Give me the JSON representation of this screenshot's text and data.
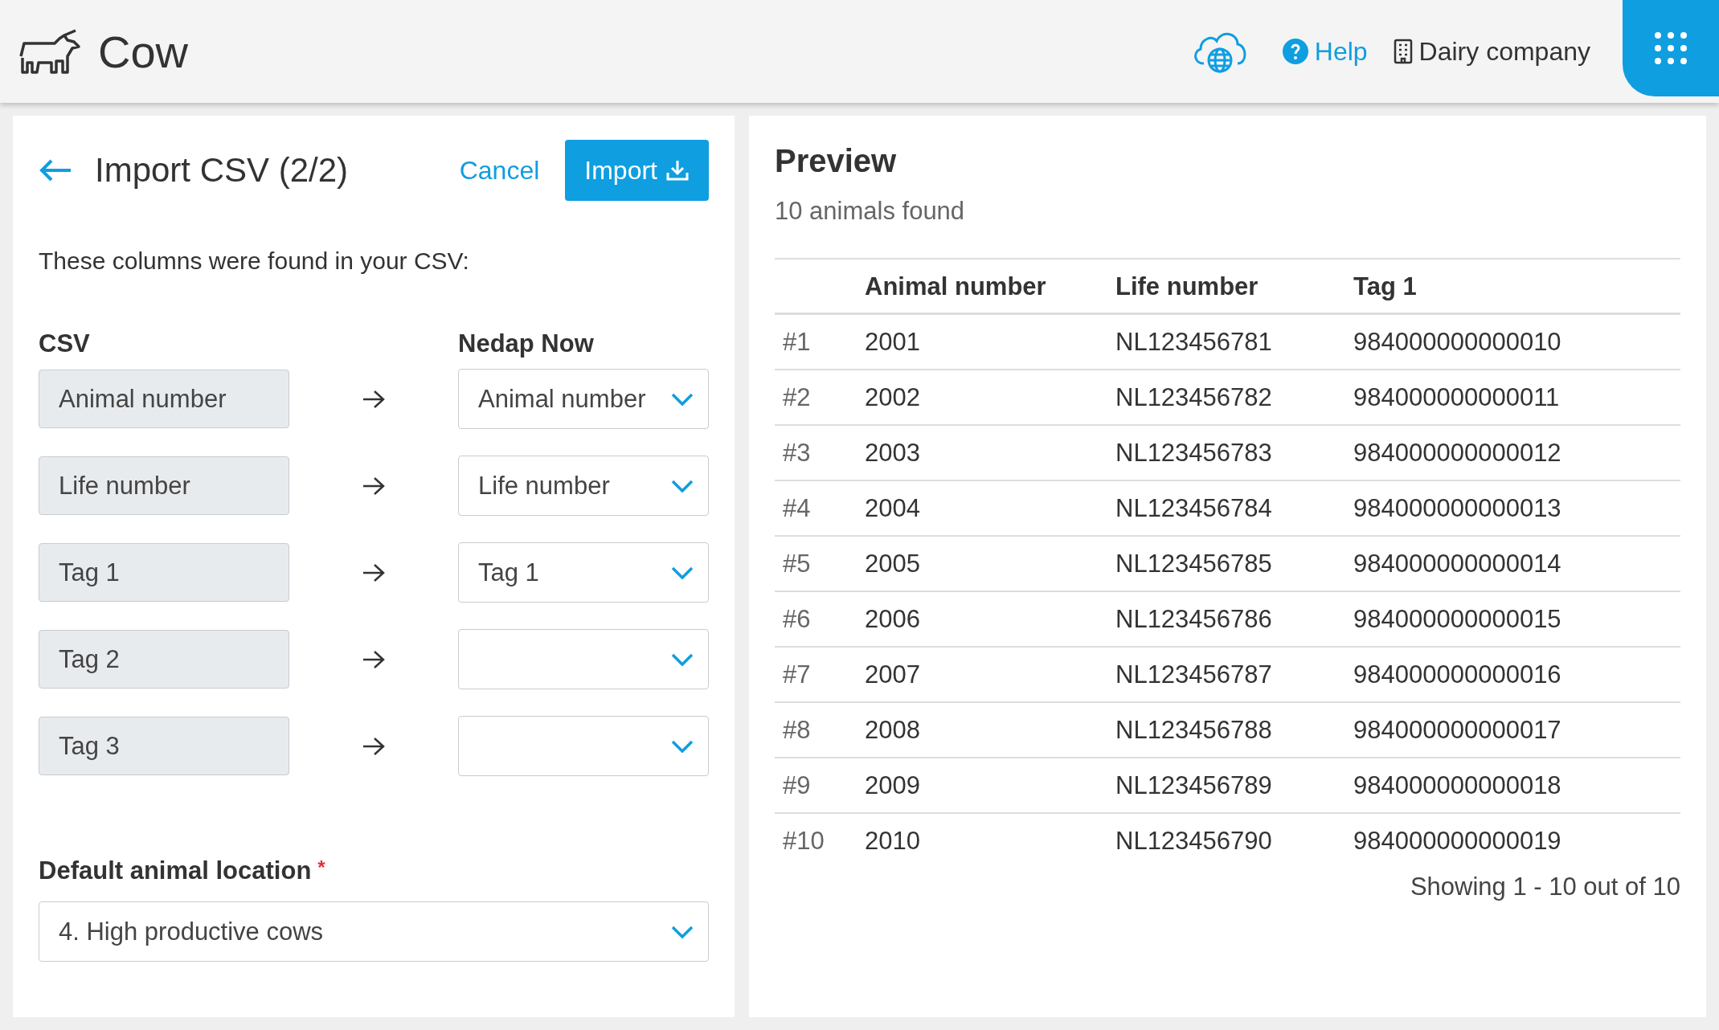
{
  "header": {
    "app_name": "Cow",
    "help": "Help",
    "company": "Dairy company"
  },
  "import": {
    "title": "Import CSV (2/2)",
    "cancel": "Cancel",
    "import_button": "Import",
    "intro": "These columns were found in your CSV:",
    "csv_heading": "CSV",
    "target_heading": "Nedap Now",
    "mappings": [
      {
        "csv": "Animal number",
        "target": "Animal number"
      },
      {
        "csv": "Life number",
        "target": "Life number"
      },
      {
        "csv": "Tag 1",
        "target": "Tag 1"
      },
      {
        "csv": "Tag 2"
      },
      {
        "csv": "Tag 3"
      }
    ],
    "location_label": "Default animal location",
    "location_required_mark": "*",
    "location_value": "4. High productive cows"
  },
  "preview": {
    "title": "Preview",
    "subtitle": "10 animals found",
    "columns": [
      "",
      "Animal number",
      "Life number",
      "Tag 1"
    ],
    "rows": [
      [
        "#1",
        "2001",
        "NL123456781",
        "984000000000010"
      ],
      [
        "#2",
        "2002",
        "NL123456782",
        "984000000000011"
      ],
      [
        "#3",
        "2003",
        "NL123456783",
        "984000000000012"
      ],
      [
        "#4",
        "2004",
        "NL123456784",
        "984000000000013"
      ],
      [
        "#5",
        "2005",
        "NL123456785",
        "984000000000014"
      ],
      [
        "#6",
        "2006",
        "NL123456786",
        "984000000000015"
      ],
      [
        "#7",
        "2007",
        "NL123456787",
        "984000000000016"
      ],
      [
        "#8",
        "2008",
        "NL123456788",
        "984000000000017"
      ],
      [
        "#9",
        "2009",
        "NL123456789",
        "984000000000018"
      ],
      [
        "#10",
        "2010",
        "NL123456790",
        "984000000000019"
      ]
    ],
    "pagination": "Showing 1 - 10 out of 10"
  }
}
